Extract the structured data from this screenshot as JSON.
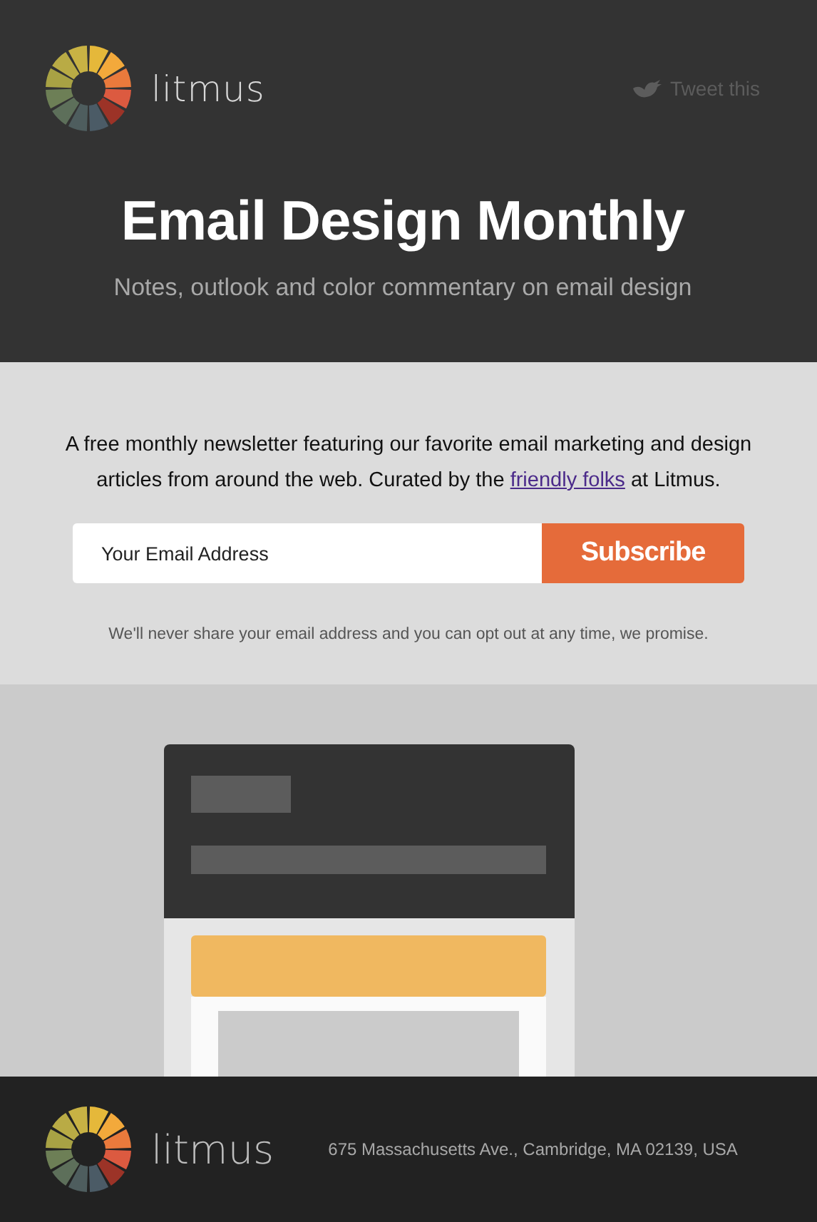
{
  "header": {
    "brand": "litmus",
    "tweet_link": "Tweet this",
    "title": "Email Design Monthly",
    "subtitle": "Notes, outlook and color commentary on email design"
  },
  "signup": {
    "intro_before": "A free monthly newsletter featuring our favorite email marketing and design articles from around the web. Curated by the ",
    "intro_link": "friendly folks",
    "intro_after": " at Litmus.",
    "email_placeholder": "Your Email Address",
    "button": "Subscribe",
    "note": "We'll never share your email address and you can opt out at any time, we promise."
  },
  "footer": {
    "brand": "litmus",
    "address": "675 Massachusetts Ave., Cambridge, MA 02139, USA"
  }
}
